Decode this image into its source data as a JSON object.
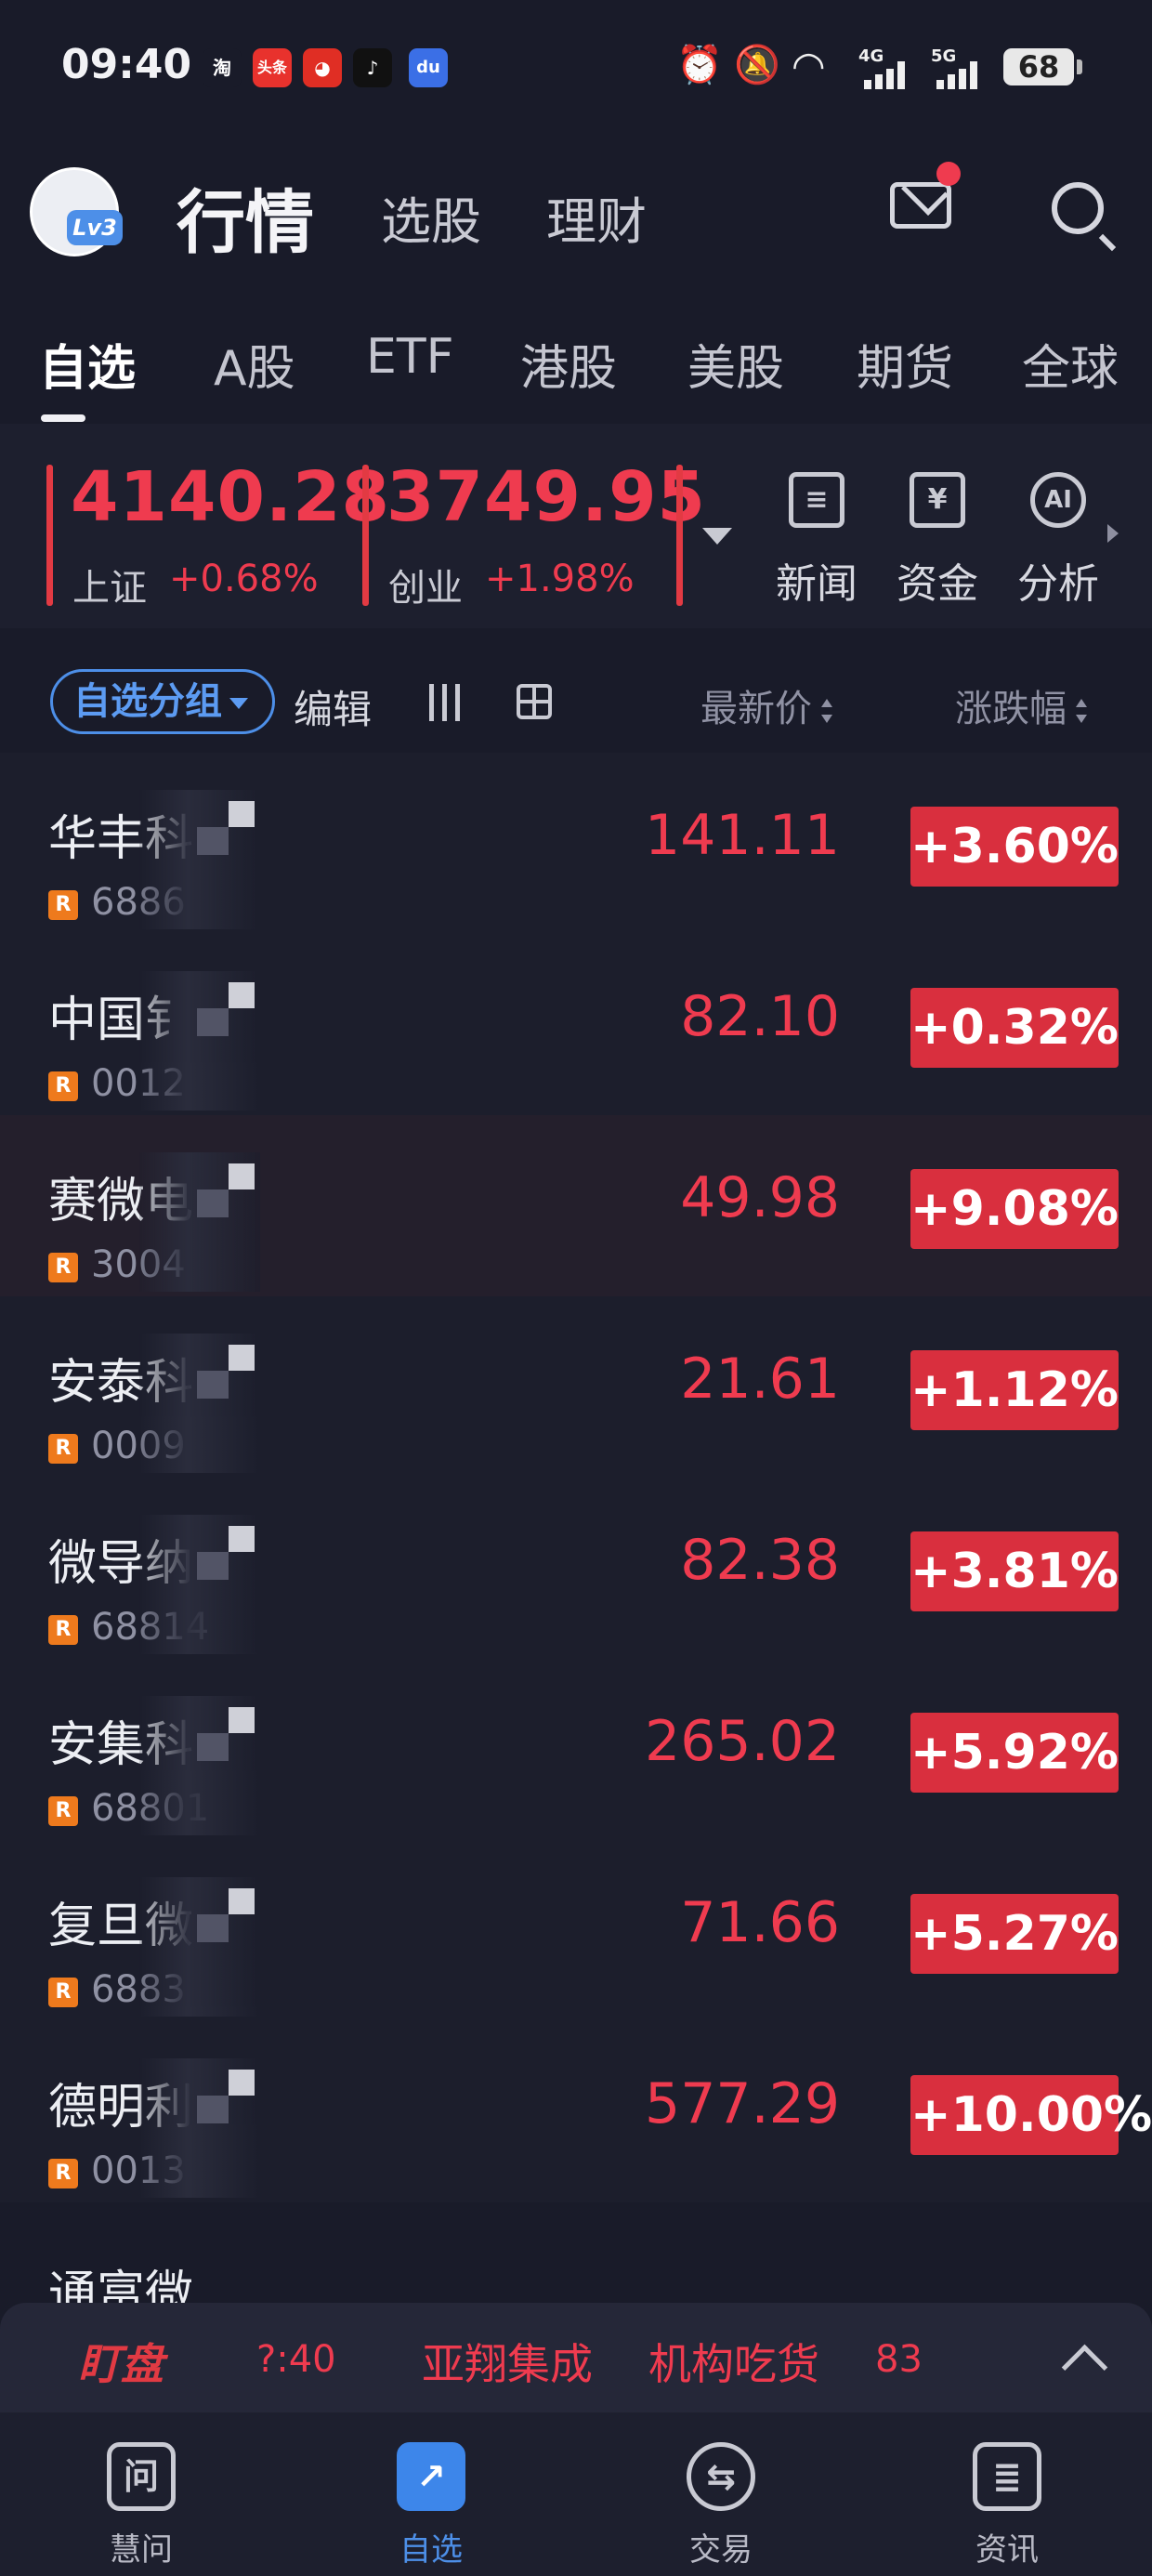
{
  "status_bar": {
    "time": "09:40",
    "apps": [
      {
        "icon": "taobao-icon",
        "label": "淘",
        "color": "#191b29"
      },
      {
        "icon": "toutiao-icon",
        "label": "头条",
        "color": "#e8322d"
      },
      {
        "icon": "pinduoduo-icon",
        "label": "",
        "color": "#e02e24"
      },
      {
        "icon": "douyin-icon",
        "label": "♪",
        "color": "#111111"
      },
      {
        "icon": "baidu-icon",
        "label": "du",
        "color": "#3b6fe6"
      }
    ],
    "right_icons": [
      "alarm-icon",
      "mute-icon",
      "wifi-icon",
      "signal-4g-icon",
      "signal-5g-icon"
    ],
    "network_1": "4G",
    "network_2": "5G",
    "battery": "68"
  },
  "header": {
    "avatar_level": "Lv3",
    "title": "行情",
    "links": [
      "选股",
      "理财"
    ]
  },
  "categories": [
    "自选",
    "A股",
    "ETF",
    "港股",
    "美股",
    "期货",
    "全球"
  ],
  "indices": [
    {
      "value": "4140.28",
      "name": "上证",
      "change": "+0.68%"
    },
    {
      "value": "3749.95",
      "name": "创业",
      "change": "+1.98%"
    }
  ],
  "tools": [
    {
      "label": "新闻",
      "icon": "news-icon",
      "glyph": "≡"
    },
    {
      "label": "资金",
      "icon": "funds-icon",
      "glyph": "¥"
    },
    {
      "label": "分析",
      "icon": "ai-analysis-icon",
      "glyph": "AI"
    }
  ],
  "filter_bar": {
    "group_label": "自选分组",
    "edit_label": "编辑",
    "col_price": "最新价",
    "col_change": "涨跌幅"
  },
  "stocks": [
    {
      "name": "华丰科",
      "badge": "R",
      "code": "6886",
      "price": "141.11",
      "change": "+3.60%"
    },
    {
      "name": "中国钅",
      "badge": "R",
      "code": "0012",
      "price": "82.10",
      "change": "+0.32%"
    },
    {
      "name": "赛微电",
      "badge": "R",
      "code": "3004",
      "price": "49.98",
      "change": "+9.08%"
    },
    {
      "name": "安泰科",
      "badge": "R",
      "code": "0009",
      "price": "21.61",
      "change": "+1.12%"
    },
    {
      "name": "微导纳",
      "badge": "R",
      "code": "68814",
      "price": "82.38",
      "change": "+3.81%"
    },
    {
      "name": "安集科",
      "badge": "R",
      "code": "68801",
      "price": "265.02",
      "change": "+5.92%"
    },
    {
      "name": "复旦微",
      "badge": "R",
      "code": "6883",
      "price": "71.66",
      "change": "+5.27%"
    },
    {
      "name": "德明利",
      "badge": "R",
      "code": "0013",
      "price": "577.29",
      "change": "+10.00%"
    },
    {
      "name": "通富微",
      "badge": "",
      "code": "",
      "price": "",
      "change": ""
    }
  ],
  "marquee": {
    "logo": "盯盘",
    "time": "?:40",
    "stock": "亚翔集成",
    "tag": "机构吃货",
    "number": "83"
  },
  "bottom_nav": [
    {
      "label": "慧问",
      "icon": "ask-icon",
      "glyph": "问",
      "active": false
    },
    {
      "label": "自选",
      "icon": "watchlist-chart-icon",
      "glyph": "↗",
      "active": true
    },
    {
      "label": "交易",
      "icon": "trade-exchange-icon",
      "glyph": "⇆",
      "active": false
    },
    {
      "label": "资讯",
      "icon": "news-doc-icon",
      "glyph": "≣",
      "active": false
    }
  ],
  "colors": {
    "background": "#191b29",
    "up_red": "#ef3b4f",
    "badge_red": "#d92f3e",
    "accent_blue": "#4d8fe8",
    "badge_orange": "#ee7a1d"
  }
}
